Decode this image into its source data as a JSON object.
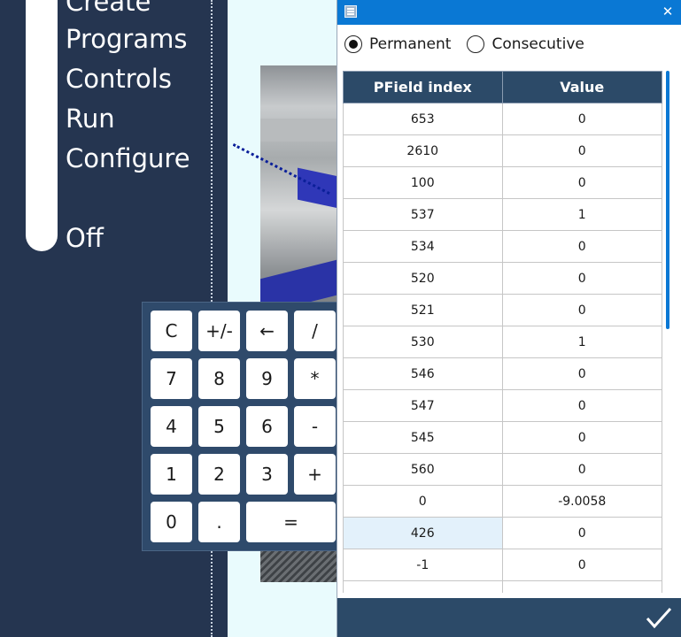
{
  "sidebar": {
    "items": [
      {
        "label": "Create"
      },
      {
        "label": "Programs"
      },
      {
        "label": "Controls"
      },
      {
        "label": "Run"
      },
      {
        "label": "Configure"
      },
      {
        "label": "Off"
      }
    ]
  },
  "keypad": {
    "keys": [
      "C",
      "+/-",
      "←",
      "/",
      "7",
      "8",
      "9",
      "*",
      "4",
      "5",
      "6",
      "-",
      "1",
      "2",
      "3",
      "+",
      "0",
      ".",
      "="
    ]
  },
  "dialog": {
    "radios": [
      {
        "label": "Permanent",
        "checked": true
      },
      {
        "label": "Consecutive",
        "checked": false
      }
    ],
    "table": {
      "headers": [
        "PField index",
        "Value"
      ],
      "rows": [
        {
          "index": "653",
          "value": "0"
        },
        {
          "index": "2610",
          "value": "0"
        },
        {
          "index": "100",
          "value": "0"
        },
        {
          "index": "537",
          "value": "1"
        },
        {
          "index": "534",
          "value": "0"
        },
        {
          "index": "520",
          "value": "0"
        },
        {
          "index": "521",
          "value": "0"
        },
        {
          "index": "530",
          "value": "1"
        },
        {
          "index": "546",
          "value": "0"
        },
        {
          "index": "547",
          "value": "0"
        },
        {
          "index": "545",
          "value": "0"
        },
        {
          "index": "560",
          "value": "0"
        },
        {
          "index": "0",
          "value": "-9.0058"
        },
        {
          "index": "426",
          "value": "0",
          "selected": true
        },
        {
          "index": "-1",
          "value": "0"
        },
        {
          "index": "",
          "value": ""
        }
      ]
    }
  },
  "colors": {
    "sidebar_bg": "#253550",
    "titlebar": "#0a78d4",
    "header_bg": "#2c4a68",
    "selected_cell": "#e3f1fb"
  },
  "icons": {
    "app": "window-icon",
    "close": "close-icon",
    "confirm": "checkmark-icon"
  }
}
